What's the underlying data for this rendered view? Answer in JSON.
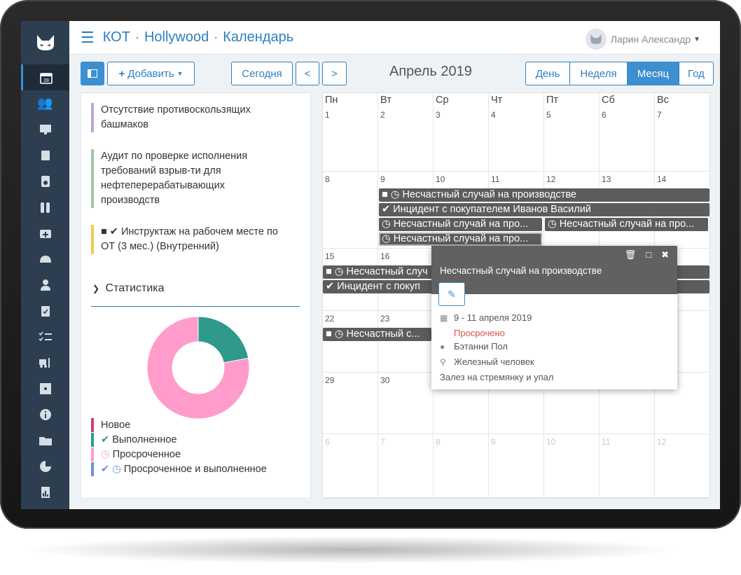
{
  "header": {
    "crumbs": [
      "КОТ",
      "Hollywood",
      "Календарь"
    ],
    "user": "Ларин Александр"
  },
  "toolbar": {
    "add_label": "Добавить",
    "today_label": "Сегодня",
    "prev_label": "<",
    "next_label": ">",
    "month_title": "Апрель 2019",
    "views": [
      "День",
      "Неделя",
      "Месяц",
      "Год"
    ],
    "active_view": "Месяц"
  },
  "tasks": [
    {
      "text_l1": "Отсутствие противоскользящих",
      "text_l2": "башмаков",
      "color": "#b9a7d6"
    },
    {
      "text_l1": "Аудит по проверке исполнения",
      "text_l2": "требований взрыв-ти для",
      "text_l3": "нефтеперерабатывающих",
      "text_l4": "производств",
      "color": "#9cc9a8"
    },
    {
      "text_l1": "Инструктаж на рабочем месте по",
      "text_l2": "ОТ (3 мес.) (Внутренний)",
      "color": "#f2c94c"
    }
  ],
  "stats": {
    "title": "Статистика",
    "legend": [
      {
        "label": "Новое",
        "color": "#d63a6b"
      },
      {
        "label": "Выполненное",
        "color": "#2f9a8c"
      },
      {
        "label": "Просроченное",
        "color": "#ff9ccb"
      },
      {
        "label": "Просроченное и выполненное",
        "color": "#6b8fe0"
      }
    ]
  },
  "chart_data": {
    "type": "pie",
    "categories": [
      "Выполненное",
      "Просроченное"
    ],
    "values": [
      22,
      78
    ],
    "colors": [
      "#2f9a8c",
      "#ff9ccb"
    ]
  },
  "calendar": {
    "dow": [
      "Пн",
      "Вт",
      "Ср",
      "Чт",
      "Пт",
      "Сб",
      "Вс"
    ],
    "weeks": [
      [
        "1",
        "2",
        "3",
        "4",
        "5",
        "6",
        "7"
      ],
      [
        "8",
        "9",
        "10",
        "11",
        "12",
        "13",
        "14"
      ],
      [
        "15",
        "16",
        "",
        "",
        "",
        "",
        ""
      ],
      [
        "22",
        "23",
        "",
        "",
        "",
        "",
        ""
      ],
      [
        "29",
        "30",
        "",
        "",
        "",
        "",
        ""
      ],
      [
        "6",
        "7",
        "8",
        "9",
        "10",
        "11",
        "12"
      ]
    ],
    "events": {
      "ev1": "Несчастный случай на производстве",
      "ev2": "Инцидент с покупателем Иванов Василий",
      "ev3": "Несчастный случай на про...",
      "ev4": "Несчастный случай на про...",
      "ev5": "Несчастный случай на про...",
      "ev6": "Несчастный случ",
      "ev7": "Инцидент с покуп",
      "ev8": "Несчастный с..."
    }
  },
  "popup": {
    "title": "Несчастный случай на производстве",
    "dates": "9 - 11 апреля 2019",
    "status": "Просрочено",
    "person": "Бэтанни Пол",
    "place": "Железный человек",
    "description": "Залез на стремянку и упал"
  }
}
